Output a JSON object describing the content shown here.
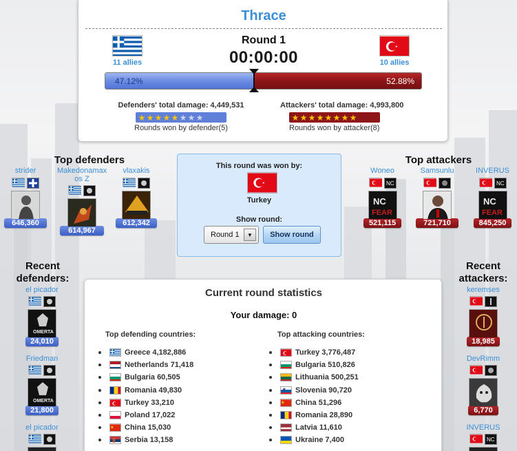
{
  "battle": {
    "region": "Thrace",
    "round_label": "Round 1",
    "timer": "00:00:00",
    "defender": {
      "allies": "11 allies",
      "percent": "47.12%",
      "percent_value": 47.12,
      "damage_label": "Defenders' total damage: 4,449,531",
      "rounds_won_label": "Rounds won by defender(5)",
      "rounds_won": 5,
      "rounds_total": 8
    },
    "attacker": {
      "allies": "10 allies",
      "percent": "52.88%",
      "percent_value": 52.88,
      "damage_label": "Attackers' total damage: 4,993,800",
      "rounds_won_label": "Rounds won by attacker(8)",
      "rounds_won": 8,
      "rounds_total": 8
    }
  },
  "top_defenders": {
    "title": "Top defenders",
    "players": [
      {
        "name": "strider",
        "damage": "646,360"
      },
      {
        "name": "Makedonamax os Z",
        "damage": "614,967"
      },
      {
        "name": "vlaxakis",
        "damage": "612,342"
      }
    ]
  },
  "top_attackers": {
    "title": "Top attackers",
    "players": [
      {
        "name": "Woneo",
        "damage": "521,115"
      },
      {
        "name": "Samsunlu",
        "damage": "721,710"
      },
      {
        "name": "INVERUS",
        "damage": "845,250"
      }
    ]
  },
  "round_result": {
    "won_by_label": "This round was won by:",
    "winner": "Turkey",
    "show_round_label": "Show round:",
    "selected_round": "Round 1",
    "show_button": "Show round"
  },
  "recent_defenders": {
    "title_line1": "Recent",
    "title_line2": "defenders:",
    "players": [
      {
        "name": "el picador",
        "damage": "24,010"
      },
      {
        "name": "Friedman",
        "damage": "21,800"
      },
      {
        "name": "el picador",
        "damage": ""
      }
    ]
  },
  "recent_attackers": {
    "title_line1": "Recent",
    "title_line2": "attackers:",
    "players": [
      {
        "name": "keremses",
        "damage": "18,985"
      },
      {
        "name": "DevRimm",
        "damage": "6,770"
      },
      {
        "name": "INVERUS",
        "damage": ""
      }
    ]
  },
  "stats": {
    "title": "Current round statistics",
    "your_damage": "Your damage: 0",
    "defending_title": "Top defending countries:",
    "attacking_title": "Top attacking countries:",
    "defending": [
      {
        "label": "Greece 4,182,886",
        "flag": "greece"
      },
      {
        "label": "Netherlands 71,418",
        "flag": "netherlands"
      },
      {
        "label": "Bulgaria 60,505",
        "flag": "bulgaria"
      },
      {
        "label": "Romania 49,830",
        "flag": "romania"
      },
      {
        "label": "Turkey 33,210",
        "flag": "turkey"
      },
      {
        "label": "Poland 17,022",
        "flag": "poland"
      },
      {
        "label": "China 15,030",
        "flag": "china"
      },
      {
        "label": "Serbia 13,158",
        "flag": "serbia"
      }
    ],
    "attacking": [
      {
        "label": "Turkey 3,776,487",
        "flag": "turkey"
      },
      {
        "label": "Bulgaria 510,826",
        "flag": "bulgaria"
      },
      {
        "label": "Lithuania 500,251",
        "flag": "lithuania"
      },
      {
        "label": "Slovenia 90,720",
        "flag": "slovenia"
      },
      {
        "label": "China 51,296",
        "flag": "china"
      },
      {
        "label": "Romania 28,890",
        "flag": "romania"
      },
      {
        "label": "Latvia 11,610",
        "flag": "latvia"
      },
      {
        "label": "Ukraine 7,400",
        "flag": "ukraine"
      }
    ]
  },
  "colors": {
    "accent_blue": "#3c8fd6",
    "defender_blue": "#5274d6",
    "attacker_red": "#8d1517",
    "star_gold": "#f5c400"
  }
}
